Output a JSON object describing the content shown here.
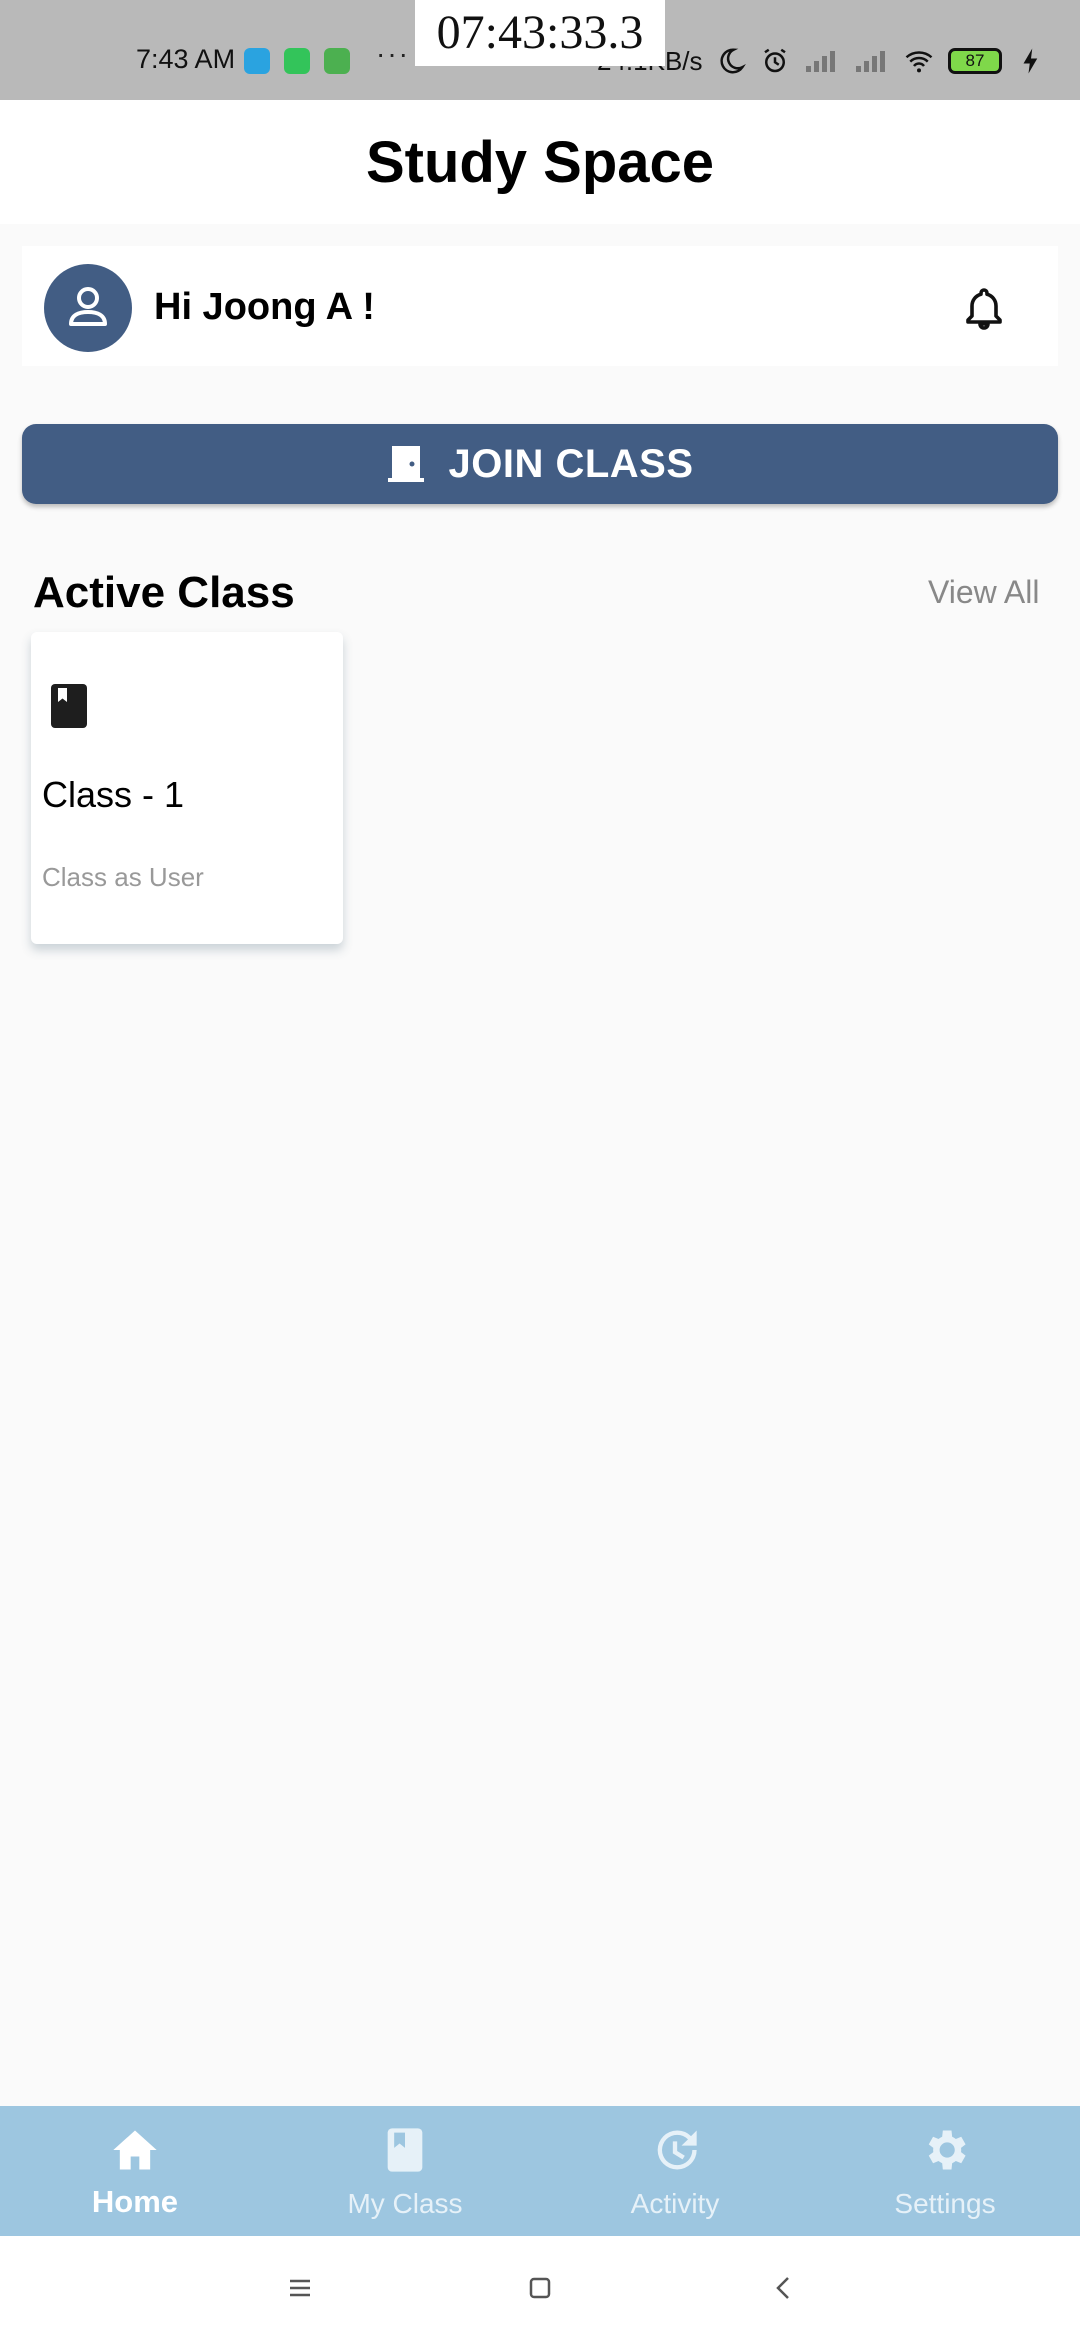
{
  "status_bar": {
    "time": "7:43 AM",
    "clock_overlay": "07:43:33.3",
    "more": "···",
    "network_speed": "24.1KB/s",
    "battery_level": "87"
  },
  "app_bar": {
    "title": "Study Space"
  },
  "user": {
    "greeting": "Hi Joong A !"
  },
  "join_button": {
    "label": "JOIN CLASS"
  },
  "active_section": {
    "title": "Active Class",
    "view_all": "View All",
    "classes": [
      {
        "name": "Class - 1",
        "role": "Class as User",
        "icon": "book-icon"
      }
    ]
  },
  "bottom_nav": {
    "items": [
      {
        "label": "Home",
        "icon": "home-icon",
        "active": true
      },
      {
        "label": "My Class",
        "icon": "book-icon",
        "active": false
      },
      {
        "label": "Activity",
        "icon": "history-icon",
        "active": false
      },
      {
        "label": "Settings",
        "icon": "gear-icon",
        "active": false
      }
    ]
  },
  "colors": {
    "primary": "#425d84",
    "nav_background": "#9dc6e0",
    "page_background": "#fafafa"
  }
}
